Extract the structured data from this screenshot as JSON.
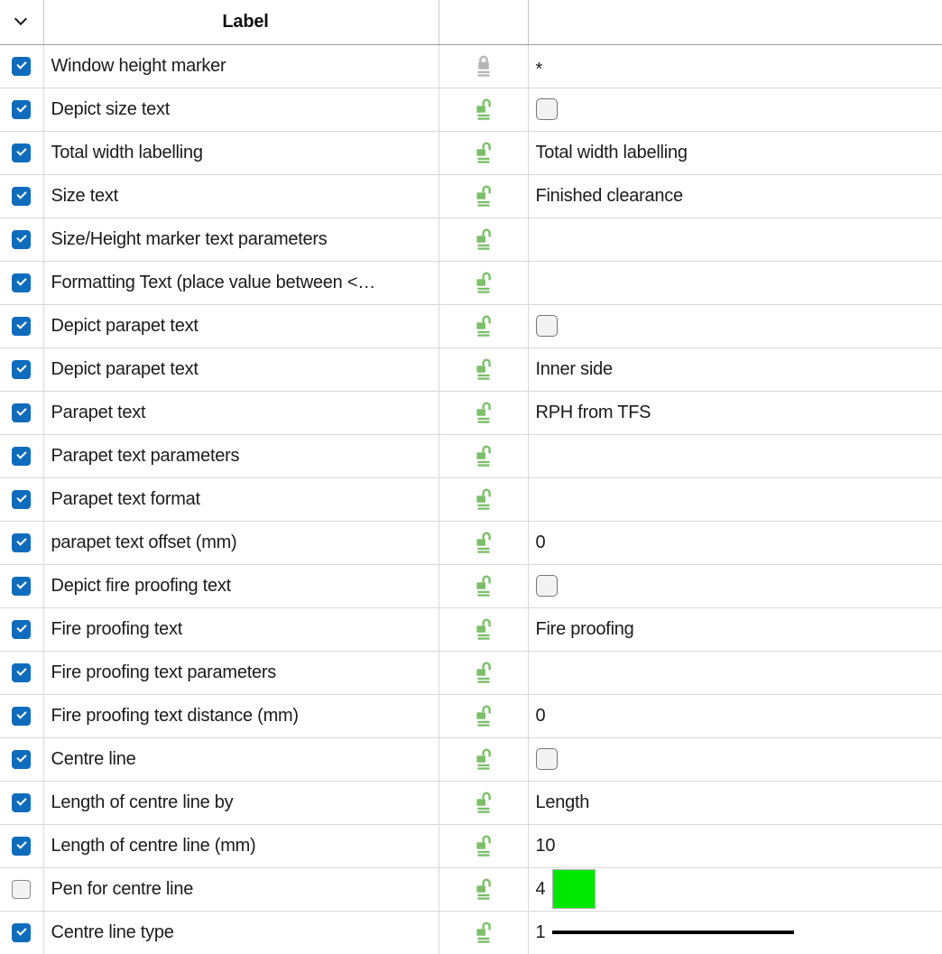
{
  "header": {
    "expand_icon": "chevron-down-icon",
    "label_column": "Label",
    "lock_column": "",
    "value_column": ""
  },
  "colors": {
    "checkbox_checked": "#0f6cbd",
    "checkbox_unchecked_fill": "#f3f3f3",
    "lock_open": "#7cbf6a",
    "lock_closed": "#b5b5b5",
    "pen_swatch": "#00e800",
    "line_preview": "#000000",
    "grid_line": "#d8d8d8"
  },
  "rows": [
    {
      "checked": true,
      "label": "Window height marker",
      "lock": "locked",
      "value_type": "text",
      "value": "*"
    },
    {
      "checked": true,
      "label": "Depict size text",
      "lock": "unlocked",
      "value_type": "checkbox",
      "value": "",
      "value_checked": false
    },
    {
      "checked": true,
      "label": "Total width labelling",
      "lock": "unlocked",
      "value_type": "text",
      "value": "Total width labelling"
    },
    {
      "checked": true,
      "label": "Size text",
      "lock": "unlocked",
      "value_type": "text",
      "value": "Finished clearance"
    },
    {
      "checked": true,
      "label": "Size/Height marker text parameters",
      "lock": "unlocked",
      "value_type": "text",
      "value": ""
    },
    {
      "checked": true,
      "label": "Formatting Text (place value between <…",
      "lock": "unlocked",
      "value_type": "text",
      "value": ""
    },
    {
      "checked": true,
      "label": "Depict parapet text",
      "lock": "unlocked",
      "value_type": "checkbox",
      "value": "",
      "value_checked": false
    },
    {
      "checked": true,
      "label": "Depict parapet text",
      "lock": "unlocked",
      "value_type": "text",
      "value": "Inner side"
    },
    {
      "checked": true,
      "label": "Parapet text",
      "lock": "unlocked",
      "value_type": "text",
      "value": "RPH from TFS"
    },
    {
      "checked": true,
      "label": "Parapet text parameters",
      "lock": "unlocked",
      "value_type": "text",
      "value": ""
    },
    {
      "checked": true,
      "label": "Parapet text format",
      "lock": "unlocked",
      "value_type": "text",
      "value": ""
    },
    {
      "checked": true,
      "label": "parapet text offset (mm)",
      "lock": "unlocked",
      "value_type": "text",
      "value": "0"
    },
    {
      "checked": true,
      "label": "Depict fire proofing text",
      "lock": "unlocked",
      "value_type": "checkbox",
      "value": "",
      "value_checked": false
    },
    {
      "checked": true,
      "label": "Fire proofing text",
      "lock": "unlocked",
      "value_type": "text",
      "value": "Fire proofing"
    },
    {
      "checked": true,
      "label": "Fire proofing text parameters",
      "lock": "unlocked",
      "value_type": "text",
      "value": ""
    },
    {
      "checked": true,
      "label": "Fire proofing text distance (mm)",
      "lock": "unlocked",
      "value_type": "text",
      "value": "0"
    },
    {
      "checked": true,
      "label": "Centre line",
      "lock": "unlocked",
      "value_type": "checkbox",
      "value": "",
      "value_checked": false
    },
    {
      "checked": true,
      "label": "Length of centre line by",
      "lock": "unlocked",
      "value_type": "text",
      "value": "Length"
    },
    {
      "checked": true,
      "label": "Length of centre line (mm)",
      "lock": "unlocked",
      "value_type": "text",
      "value": "10"
    },
    {
      "checked": false,
      "label": "Pen for centre line",
      "lock": "unlocked",
      "value_type": "color",
      "value": "4",
      "swatch": "#00e800"
    },
    {
      "checked": true,
      "label": "Centre line type",
      "lock": "unlocked",
      "value_type": "line",
      "value": "1"
    }
  ]
}
